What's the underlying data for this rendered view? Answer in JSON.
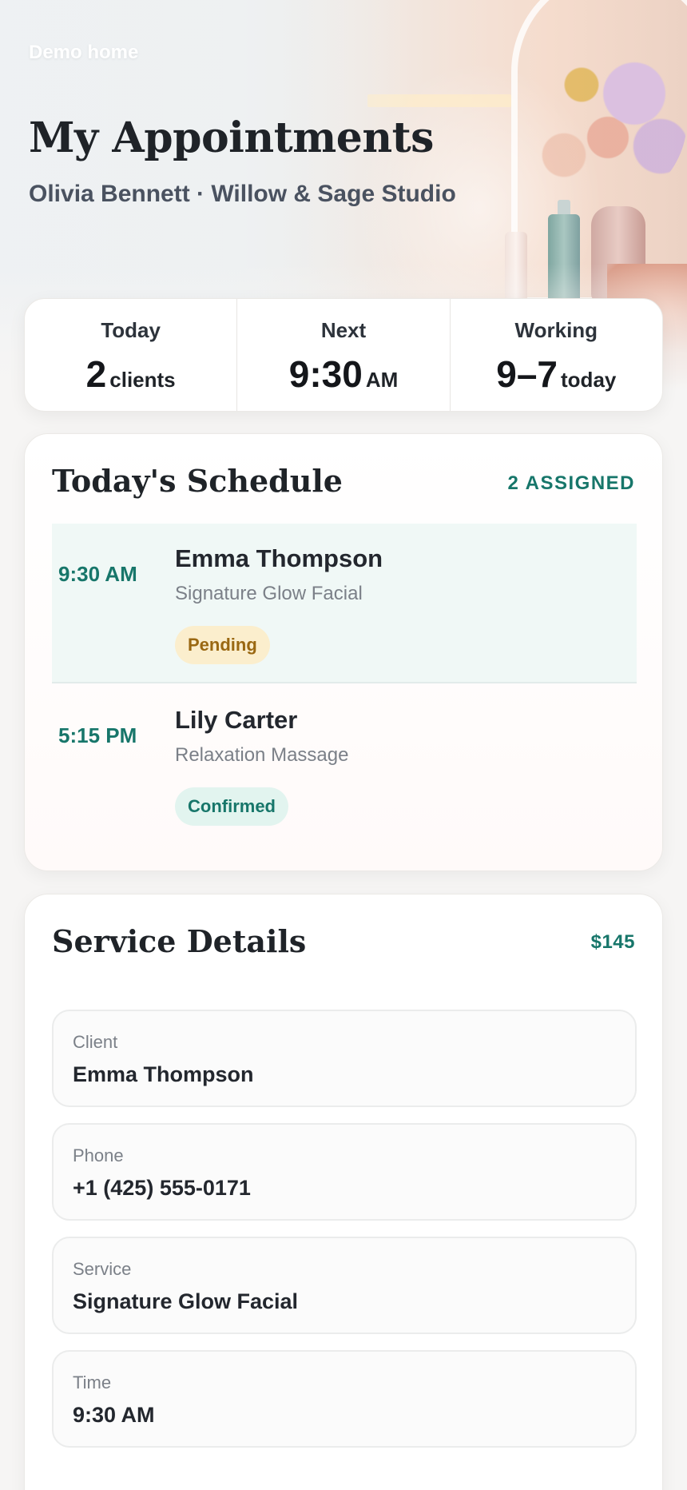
{
  "nav": {
    "demo_home_label": "Demo home"
  },
  "header": {
    "title": "My Appointments",
    "subtitle": "Olivia Bennett · Willow & Sage Studio"
  },
  "stats": [
    {
      "label": "Today",
      "value": "2",
      "unit": "clients"
    },
    {
      "label": "Next",
      "value": "9:30",
      "unit": "AM"
    },
    {
      "label": "Working",
      "value": "9–7",
      "unit": "today"
    }
  ],
  "schedule": {
    "title": "Today's Schedule",
    "assigned_label": "2 ASSIGNED",
    "appointments": [
      {
        "time": "9:30 AM",
        "client": "Emma Thompson",
        "service": "Signature Glow Facial",
        "status": "Pending",
        "selected": true
      },
      {
        "time": "5:15 PM",
        "client": "Lily Carter",
        "service": "Relaxation Massage",
        "status": "Confirmed",
        "selected": false
      }
    ]
  },
  "details": {
    "title": "Service Details",
    "price": "$145",
    "fields": [
      {
        "label": "Client",
        "value": "Emma Thompson"
      },
      {
        "label": "Phone",
        "value": "+1 (425) 555-0171"
      },
      {
        "label": "Service",
        "value": "Signature Glow Facial"
      },
      {
        "label": "Time",
        "value": "9:30 AM"
      }
    ]
  },
  "colors": {
    "accent": "#17766a",
    "pending_bg": "#fbeecd",
    "pending_text": "#9a6812",
    "confirmed_bg": "#e2f4ef",
    "selected_row_bg": "#f0f8f6"
  }
}
